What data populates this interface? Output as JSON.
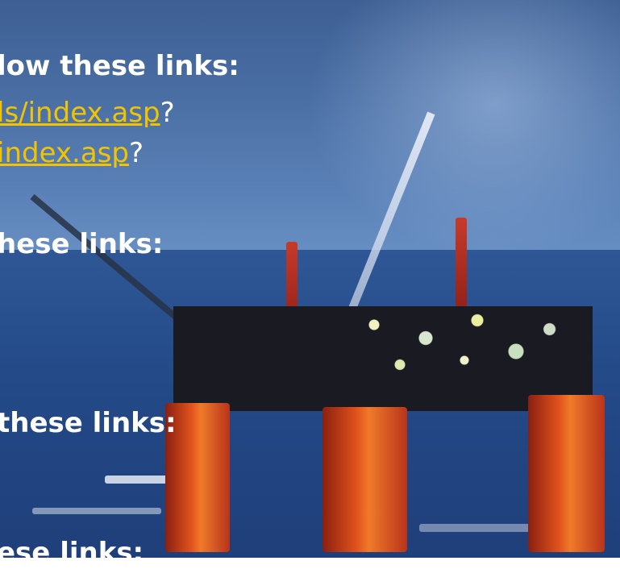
{
  "slide": {
    "lines": [
      {
        "text": "low these links:"
      },
      {
        "link": "ls/index.asp",
        "suffix": "?"
      },
      {
        "link": "index.asp",
        "suffix": "?"
      },
      {
        "text": "hese links:"
      },
      {
        "text": "these links:"
      },
      {
        "text": "ese links:"
      }
    ]
  },
  "colors": {
    "link": "#f2c400",
    "heading_text": "#ffffff",
    "sea": "#244a88"
  }
}
